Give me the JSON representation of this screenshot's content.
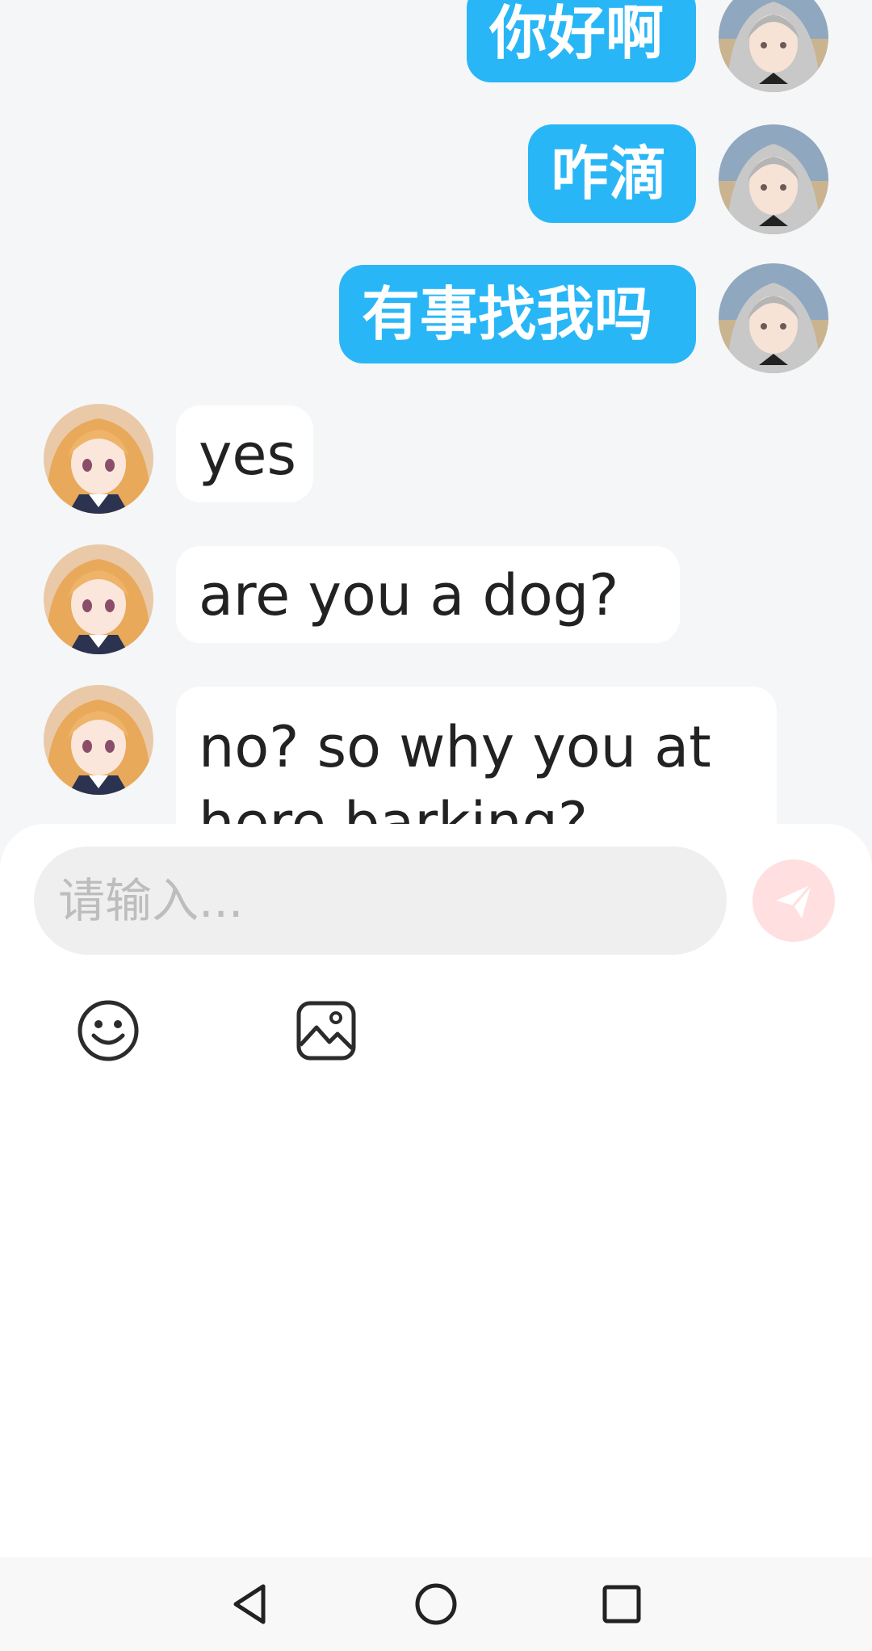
{
  "messages": [
    {
      "side": "me",
      "text": "你好啊",
      "avatar": "silver-hair-avatar"
    },
    {
      "side": "me",
      "text": "咋滴",
      "avatar": "silver-hair-avatar"
    },
    {
      "side": "me",
      "text": "有事找我吗",
      "avatar": "silver-hair-avatar"
    },
    {
      "side": "them",
      "text": "yes",
      "avatar": "orange-hair-avatar"
    },
    {
      "side": "them",
      "text": "are you a dog?",
      "avatar": "orange-hair-avatar"
    },
    {
      "side": "them",
      "text": "no?  so why you at here barking?",
      "avatar": "orange-hair-avatar"
    }
  ],
  "composer": {
    "placeholder": "请输入...",
    "value": "",
    "send_icon": "paper-plane-icon",
    "tools": [
      "smiley-icon",
      "image-icon"
    ]
  },
  "navbar": {
    "icons": [
      "back-triangle-icon",
      "home-circle-icon",
      "recents-square-icon"
    ]
  },
  "colors": {
    "my_bubble": "#29b6f6",
    "their_bubble": "#ffffff",
    "background": "#f5f6f8",
    "send_button": "#ffdfdf"
  }
}
